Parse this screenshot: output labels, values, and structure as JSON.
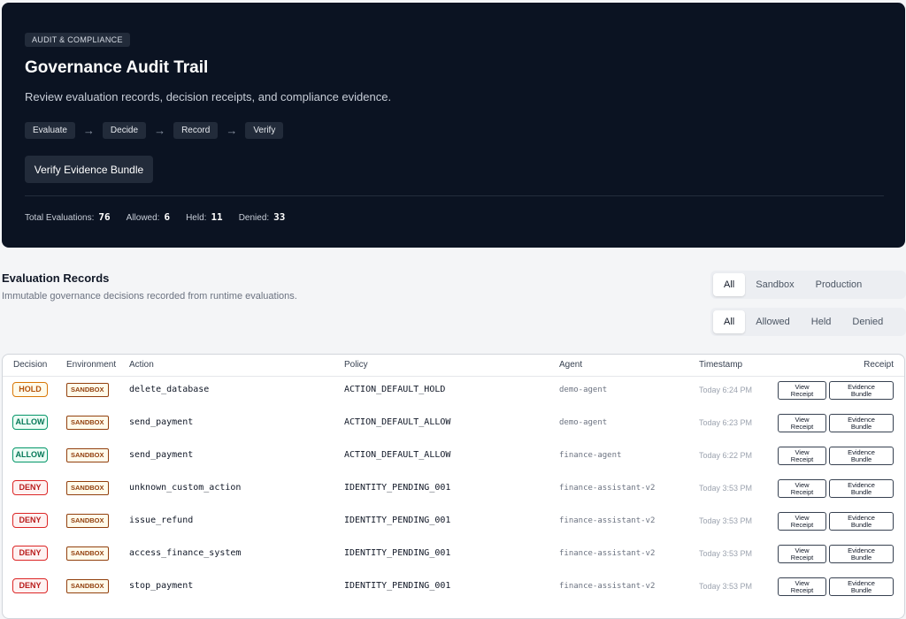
{
  "hero": {
    "badge": "AUDIT & COMPLIANCE",
    "title": "Governance Audit Trail",
    "subtitle": "Review evaluation records, decision receipts, and compliance evidence.",
    "steps": [
      "Evaluate",
      "Decide",
      "Record",
      "Verify"
    ],
    "arrow": "→",
    "verify_button": "Verify Evidence Bundle",
    "stats": [
      {
        "label": "Total Evaluations:",
        "value": "76"
      },
      {
        "label": "Allowed:",
        "value": "6"
      },
      {
        "label": "Held:",
        "value": "11"
      },
      {
        "label": "Denied:",
        "value": "33"
      }
    ]
  },
  "records": {
    "title": "Evaluation Records",
    "subtitle": "Immutable governance decisions recorded from runtime evaluations.",
    "env_filter": {
      "options": [
        "All",
        "Sandbox",
        "Production"
      ],
      "selected": "All"
    },
    "decision_filter": {
      "options": [
        "All",
        "Allowed",
        "Held",
        "Denied"
      ],
      "selected": "All"
    }
  },
  "table": {
    "columns": [
      "Decision",
      "Environment",
      "Action",
      "Policy",
      "Agent",
      "Timestamp",
      "Receipt"
    ],
    "view_receipt_label": "View\nReceipt",
    "evidence_bundle_label": "Evidence\nBundle",
    "rows": [
      {
        "decision": "HOLD",
        "environment": "SANDBOX",
        "action": "delete_database",
        "policy": "ACTION_DEFAULT_HOLD",
        "agent": "demo-agent",
        "timestamp": "Today 6:24 PM"
      },
      {
        "decision": "ALLOW",
        "environment": "SANDBOX",
        "action": "send_payment",
        "policy": "ACTION_DEFAULT_ALLOW",
        "agent": "demo-agent",
        "timestamp": "Today 6:23 PM"
      },
      {
        "decision": "ALLOW",
        "environment": "SANDBOX",
        "action": "send_payment",
        "policy": "ACTION_DEFAULT_ALLOW",
        "agent": "finance-agent",
        "timestamp": "Today 6:22 PM"
      },
      {
        "decision": "DENY",
        "environment": "SANDBOX",
        "action": "unknown_custom_action",
        "policy": "IDENTITY_PENDING_001",
        "agent": "finance-assistant-v2",
        "timestamp": "Today 3:53 PM"
      },
      {
        "decision": "DENY",
        "environment": "SANDBOX",
        "action": "issue_refund",
        "policy": "IDENTITY_PENDING_001",
        "agent": "finance-assistant-v2",
        "timestamp": "Today 3:53 PM"
      },
      {
        "decision": "DENY",
        "environment": "SANDBOX",
        "action": "access_finance_system",
        "policy": "IDENTITY_PENDING_001",
        "agent": "finance-assistant-v2",
        "timestamp": "Today 3:53 PM"
      },
      {
        "decision": "DENY",
        "environment": "SANDBOX",
        "action": "stop_payment",
        "policy": "IDENTITY_PENDING_001",
        "agent": "finance-assistant-v2",
        "timestamp": "Today 3:53 PM"
      }
    ]
  },
  "colors": {
    "hero_bg": "#0b1322",
    "hold": "#d97706",
    "allow": "#059669",
    "deny": "#dc2626",
    "sandbox": "#92400e"
  }
}
